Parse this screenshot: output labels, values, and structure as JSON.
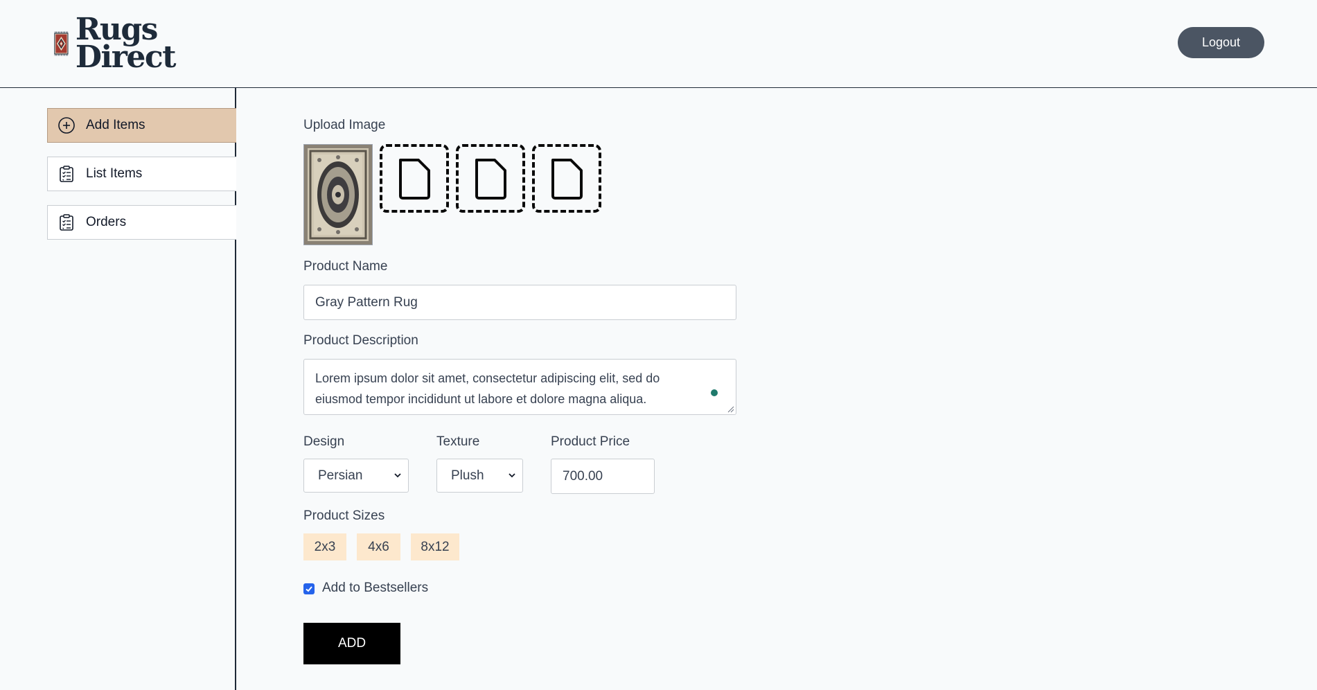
{
  "header": {
    "logo_line1": "Rugs",
    "logo_line2": "Direct",
    "logout_label": "Logout"
  },
  "sidebar": {
    "items": [
      {
        "label": "Add Items",
        "icon": "plus-circle-icon",
        "active": true
      },
      {
        "label": "List Items",
        "icon": "clipboard-list-icon",
        "active": false
      },
      {
        "label": "Orders",
        "icon": "clipboard-list-icon",
        "active": false
      }
    ]
  },
  "form": {
    "upload_label": "Upload Image",
    "product_name_label": "Product Name",
    "product_name_value": "Gray Pattern Rug",
    "description_label": "Product Description",
    "description_value": "Lorem ipsum dolor sit amet, consectetur adipiscing elit, sed do eiusmod tempor incididunt ut labore et dolore magna aliqua.",
    "design_label": "Design",
    "design_value": "Persian",
    "texture_label": "Texture",
    "texture_value": "Plush",
    "price_label": "Product Price",
    "price_value": "700.00",
    "sizes_label": "Product Sizes",
    "sizes": [
      "2x3",
      "4x6",
      "8x12"
    ],
    "bestseller_label": "Add to Bestsellers",
    "bestseller_checked": true,
    "add_label": "ADD"
  },
  "colors": {
    "accent_active": "#e2c8ae",
    "size_chip": "#fde8cd",
    "logout_bg": "#4b5563",
    "logo_red": "#a33a30"
  }
}
